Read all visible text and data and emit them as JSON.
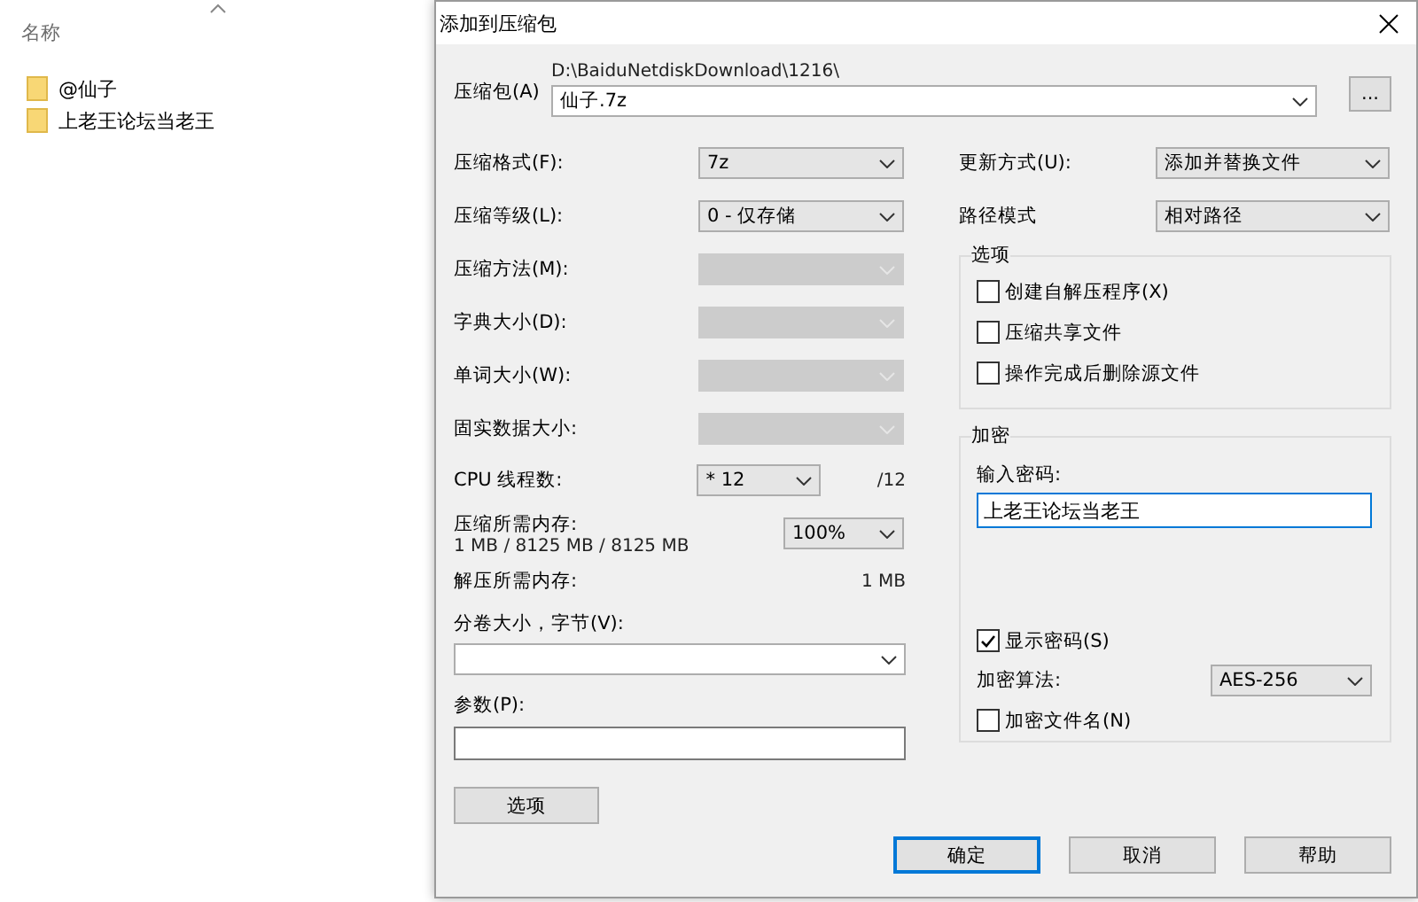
{
  "explorer": {
    "header": "名称",
    "items": [
      {
        "name": "@仙子"
      },
      {
        "name": "上老王论坛当老王"
      }
    ]
  },
  "dialog": {
    "title": "添加到压缩包",
    "archive": {
      "label": "压缩包(A)",
      "path": "D:\\BaiduNetdiskDownload\\1216\\",
      "value": "仙子.7z",
      "browse": "..."
    },
    "settings": [
      {
        "label": "压缩格式(F):",
        "value": "7z",
        "disabled": false
      },
      {
        "label": "压缩等级(L):",
        "value": "0 - 仅存储",
        "disabled": false
      },
      {
        "label": "压缩方法(M):",
        "disabled": true
      },
      {
        "label": "字典大小(D):",
        "disabled": true
      },
      {
        "label": "单词大小(W):",
        "disabled": true
      },
      {
        "label": "固实数据大小:",
        "disabled": true
      }
    ],
    "cpu": {
      "label": "CPU 线程数:",
      "value": "* 12",
      "total": "/12"
    },
    "memory": {
      "label": "压缩所需内存:",
      "detail": "1 MB / 8125 MB / 8125 MB",
      "value": "100%"
    },
    "decompress": {
      "label": "解压所需内存:",
      "value": "1 MB"
    },
    "volume": {
      "label": "分卷大小，字节(V):"
    },
    "params": {
      "label": "参数(P):"
    },
    "update": {
      "label": "更新方式(U):",
      "value": "添加并替换文件"
    },
    "path_mode": {
      "label": "路径模式",
      "value": "相对路径"
    },
    "options": {
      "title": "选项",
      "items": [
        {
          "label": "创建自解压程序(X)",
          "checked": false
        },
        {
          "label": "压缩共享文件",
          "checked": false
        },
        {
          "label": "操作完成后删除源文件",
          "checked": false
        }
      ]
    },
    "encryption": {
      "title": "加密",
      "password_label": "输入密码:",
      "password": "上老王论坛当老王",
      "show_password": {
        "label": "显示密码(S)",
        "checked": true
      },
      "method_label": "加密算法:",
      "method": "AES-256",
      "encrypt_names": {
        "label": "加密文件名(N)",
        "checked": false
      }
    },
    "options_button": "选项",
    "buttons": [
      {
        "label": "确定",
        "default": true
      },
      {
        "label": "取消",
        "default": false
      },
      {
        "label": "帮助",
        "default": false
      }
    ]
  }
}
